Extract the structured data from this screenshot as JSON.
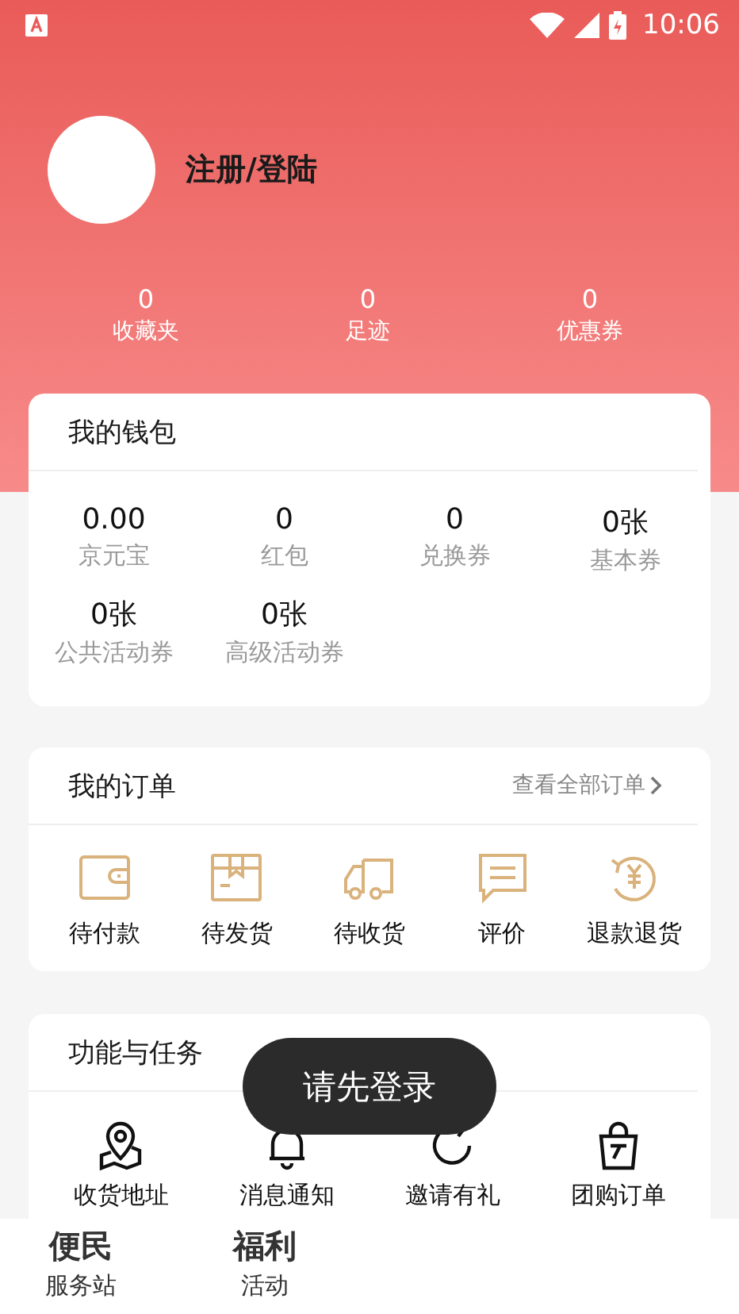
{
  "status_bar": {
    "time": "10:06"
  },
  "profile": {
    "login_label": "注册/登陆"
  },
  "stats": [
    {
      "value": "0",
      "label": "收藏夹"
    },
    {
      "value": "0",
      "label": "足迹"
    },
    {
      "value": "0",
      "label": "优惠券"
    }
  ],
  "wallet": {
    "title": "我的钱包",
    "items": [
      {
        "value": "0.00",
        "label": "京元宝"
      },
      {
        "value": "0",
        "label": "红包"
      },
      {
        "value": "0",
        "label": "兑换券"
      },
      {
        "value": "0张",
        "label": "基本券"
      },
      {
        "value": "0张",
        "label": "公共活动券"
      },
      {
        "value": "0张",
        "label": "高级活动券"
      }
    ]
  },
  "orders": {
    "title": "我的订单",
    "link": "查看全部订单",
    "items": [
      {
        "kind": "wallet",
        "label": "待付款"
      },
      {
        "kind": "box",
        "label": "待发货"
      },
      {
        "kind": "truck",
        "label": "待收货"
      },
      {
        "kind": "chat",
        "label": "评价"
      },
      {
        "kind": "refund",
        "label": "退款退货"
      }
    ]
  },
  "functions": {
    "title": "功能与任务",
    "items": [
      {
        "kind": "pin",
        "label": "收货地址"
      },
      {
        "kind": "bell",
        "label": "消息通知"
      },
      {
        "kind": "refresh",
        "label": "邀请有礼"
      },
      {
        "kind": "bag",
        "label": "团购订单"
      }
    ]
  },
  "toast": "请先登录",
  "bottom_nav": [
    {
      "title": "便民",
      "subtitle": "服务站"
    },
    {
      "title": "福利",
      "subtitle": "活动"
    }
  ]
}
